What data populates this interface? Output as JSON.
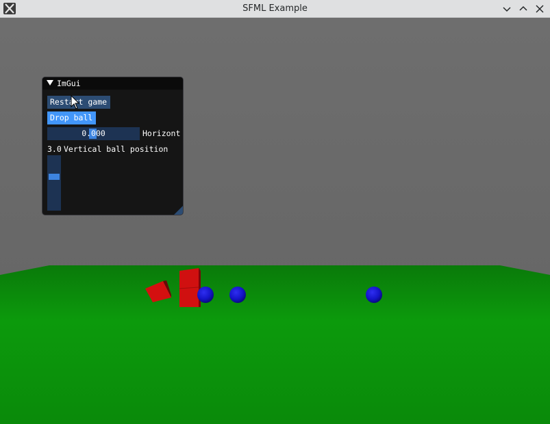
{
  "window": {
    "title": "SFML Example",
    "icons": [
      "app-icon",
      "minimize-icon",
      "maximize-icon",
      "close-icon"
    ]
  },
  "imgui": {
    "title": "ImGui",
    "restart_label": "Restart game",
    "drop_label": "Drop ball",
    "horizontal_value": "0.000",
    "horizontal_label": "Horizont",
    "vertical_value": "3.0",
    "vertical_label": "Vertical ball position",
    "vertical_level": 0.35
  },
  "scene": {
    "objects": [
      "red-cube-tilted",
      "red-cube",
      "blue-sphere",
      "blue-sphere",
      "blue-sphere"
    ],
    "colors": {
      "sky": "#6c6c6c",
      "ground": "#0a8a0a",
      "cube": "#d41010",
      "sphere": "#1010c8"
    }
  }
}
